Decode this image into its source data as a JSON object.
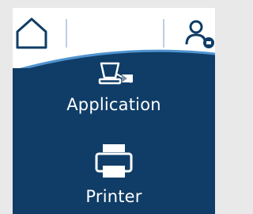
{
  "header": {
    "home_icon": "home-icon",
    "user_icon": "user-account-icon"
  },
  "menu": {
    "items": [
      {
        "label": "Application",
        "icon": "application-icon"
      },
      {
        "label": "Printer",
        "icon": "printer-icon"
      }
    ]
  },
  "colors": {
    "screen_bg": "#0f3d67",
    "topbar_bg": "#ffffff",
    "accent_arc": "#4f93cf",
    "text": "#ffffff"
  }
}
